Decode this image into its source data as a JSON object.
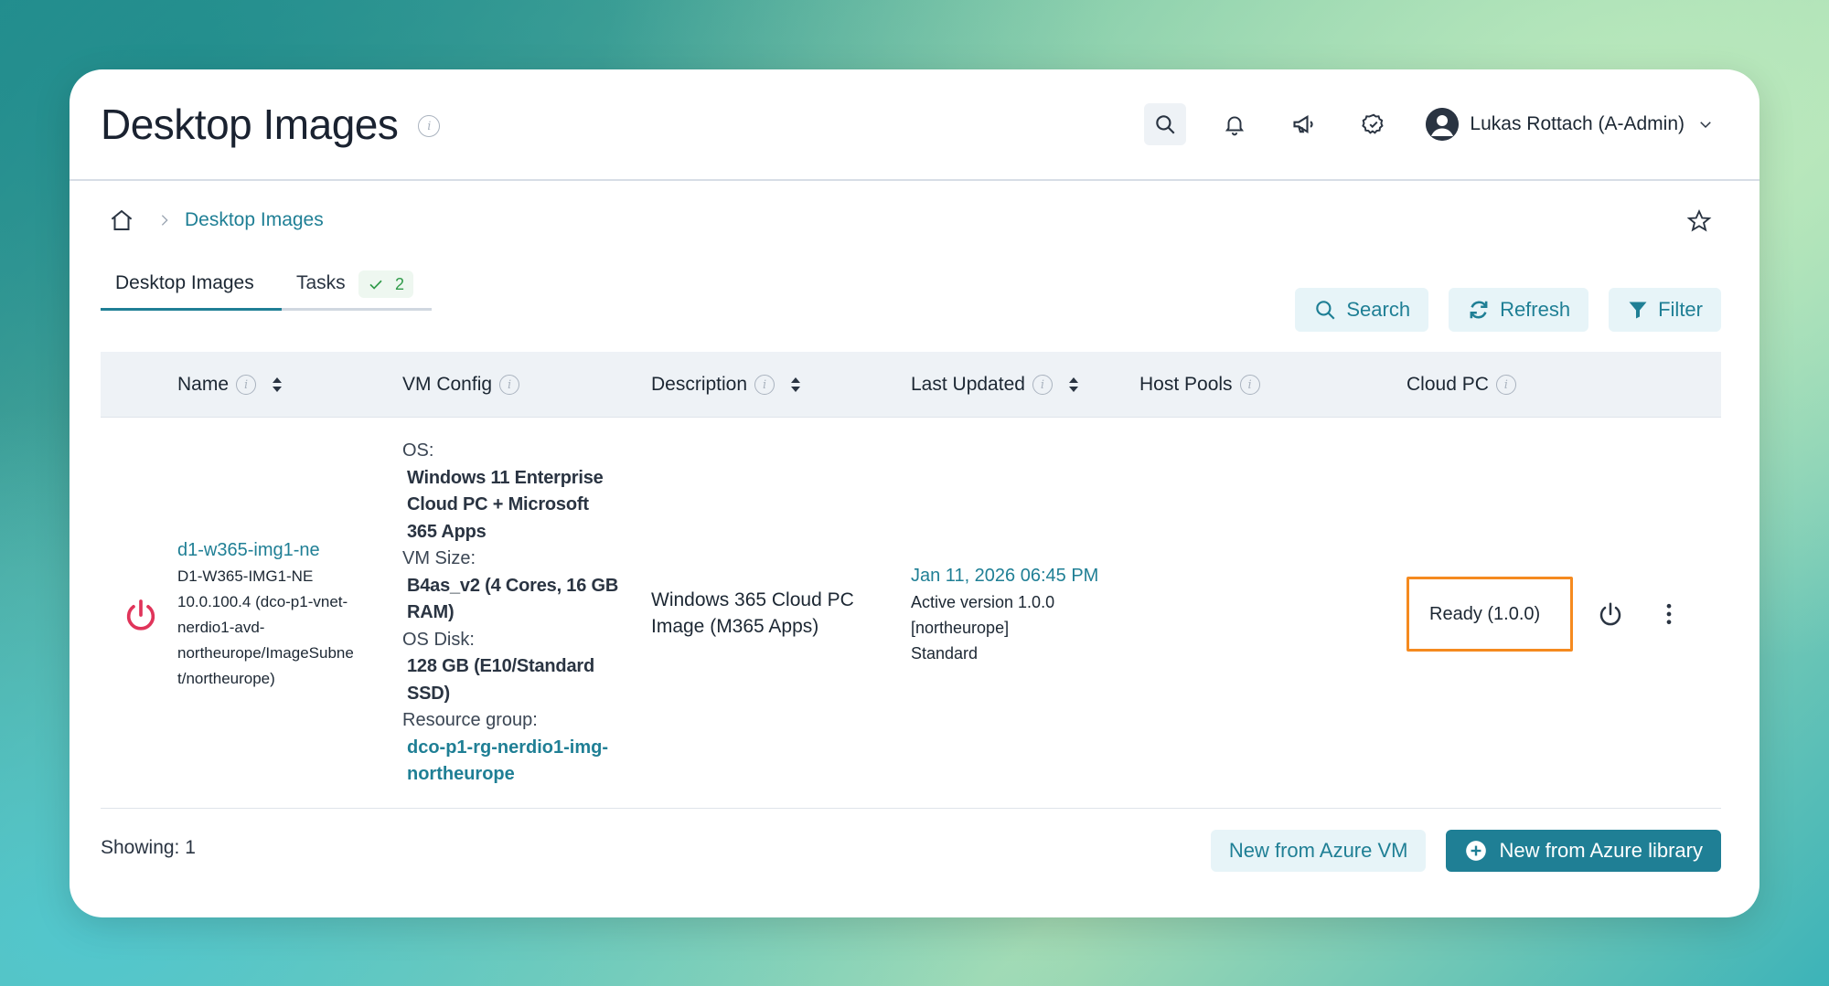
{
  "header": {
    "title": "Desktop Images",
    "user_name": "Lukas Rottach (A-Admin)"
  },
  "breadcrumb": {
    "current": "Desktop Images"
  },
  "tabs": [
    {
      "label": "Desktop Images",
      "active": true
    },
    {
      "label": "Tasks",
      "badge": "2"
    }
  ],
  "actions": {
    "search": "Search",
    "refresh": "Refresh",
    "filter": "Filter"
  },
  "table": {
    "columns": [
      "Name",
      "VM Config",
      "Description",
      "Last Updated",
      "Host Pools",
      "Cloud PC"
    ],
    "rows": [
      {
        "name_link": "d1-w365-img1-ne",
        "name_lines": [
          "D1-W365-IMG1-NE",
          "10.0.100.4 (dco-p1-vnet-",
          "nerdio1-avd-",
          "northeurope/ImageSubne",
          "t/northeurope)"
        ],
        "vm_config": {
          "os_label": "OS:",
          "os_value": [
            "Windows 11 Enterprise",
            "Cloud PC + Microsoft",
            "365 Apps"
          ],
          "size_label": "VM Size:",
          "size_value": [
            "B4as_v2 (4 Cores, 16 GB",
            "RAM)"
          ],
          "disk_label": "OS Disk:",
          "disk_value": [
            "128 GB (E10/Standard",
            "SSD)"
          ],
          "rg_label": "Resource group:",
          "rg_value": [
            "dco-p1-rg-nerdio1-img-",
            "northeurope"
          ]
        },
        "description": [
          "Windows 365 Cloud PC",
          "Image (M365 Apps)"
        ],
        "last_updated": {
          "date": "Jan 11, 2026 06:45 PM",
          "lines": [
            "Active version 1.0.0",
            "[northeurope]",
            "Standard"
          ]
        },
        "host_pools": "",
        "cloud_pc": "Ready (1.0.0)"
      }
    ]
  },
  "footer": {
    "showing": "Showing: 1",
    "new_from_vm": "New from Azure VM",
    "new_from_library": "New from Azure library"
  },
  "colors": {
    "accent": "#1f7f95",
    "highlight_border": "#f58a1f",
    "power_red": "#e0345a",
    "badge_green": "#2f9a49"
  }
}
